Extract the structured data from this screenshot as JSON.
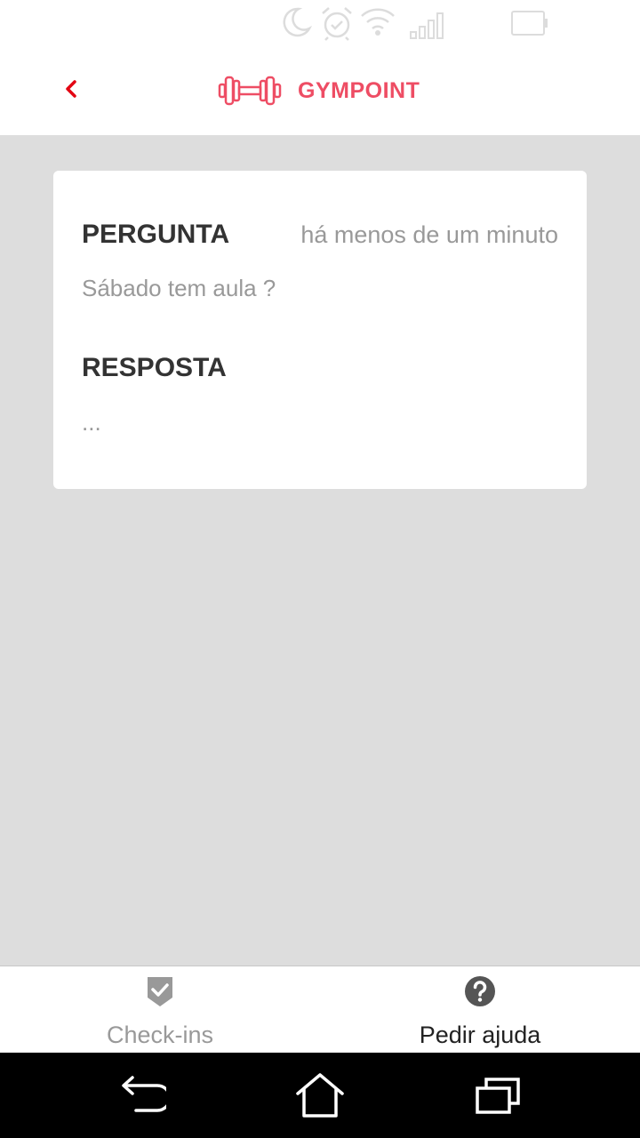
{
  "app": {
    "name": "GYMPOINT",
    "brand_color": "#ee4d64"
  },
  "header": {
    "back_icon": "chevron-left-icon",
    "logo_icon": "dumbbell-icon"
  },
  "status_bar": {
    "icons": [
      "moon-icon",
      "alarm-icon",
      "wifi-icon",
      "signal-icon",
      "battery-icon"
    ]
  },
  "card": {
    "question_title": "PERGUNTA",
    "timestamp": "há menos de um minuto",
    "question_text": "Sábado tem aula ?",
    "answer_title": "RESPOSTA",
    "answer_text": "..."
  },
  "tabs": [
    {
      "label": "Check-ins",
      "icon": "shield-check-icon",
      "active": false
    },
    {
      "label": "Pedir ajuda",
      "icon": "help-circle-icon",
      "active": true
    }
  ],
  "nav_bar": {
    "icons": [
      "back-arrow-icon",
      "home-icon",
      "recent-apps-icon"
    ]
  }
}
